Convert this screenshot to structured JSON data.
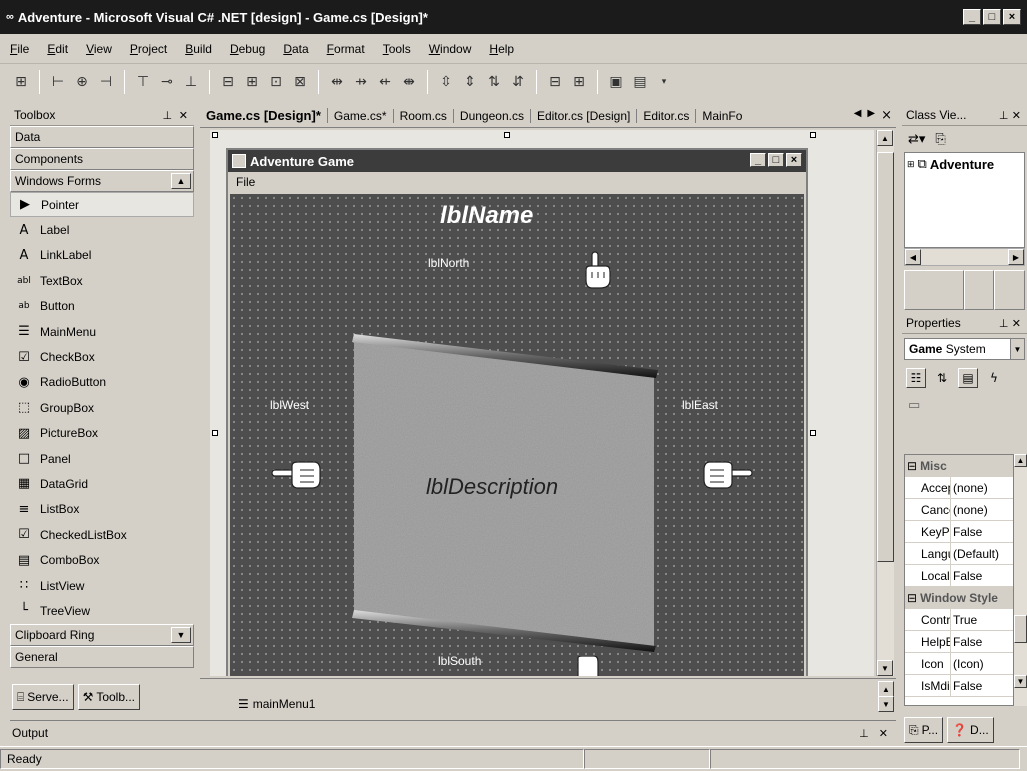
{
  "app": {
    "title": "Adventure - Microsoft Visual C# .NET [design] - Game.cs [Design]*",
    "title_icon": "∞",
    "window_buttons": [
      "_",
      "□",
      "×"
    ]
  },
  "menu": [
    "File",
    "Edit",
    "View",
    "Project",
    "Build",
    "Debug",
    "Data",
    "Format",
    "Tools",
    "Window",
    "Help"
  ],
  "toolbox": {
    "title": "Toolbox",
    "groups_top": [
      "Data",
      "Components",
      "Windows Forms"
    ],
    "items": [
      {
        "label": "Pointer",
        "icon": "▶"
      },
      {
        "label": "Label",
        "icon": "A"
      },
      {
        "label": "LinkLabel",
        "icon": "A"
      },
      {
        "label": "TextBox",
        "icon": "abl"
      },
      {
        "label": "Button",
        "icon": "ab"
      },
      {
        "label": "MainMenu",
        "icon": "☰"
      },
      {
        "label": "CheckBox",
        "icon": "☑"
      },
      {
        "label": "RadioButton",
        "icon": "◉"
      },
      {
        "label": "GroupBox",
        "icon": "⬚"
      },
      {
        "label": "PictureBox",
        "icon": "▨"
      },
      {
        "label": "Panel",
        "icon": "□"
      },
      {
        "label": "DataGrid",
        "icon": "▦"
      },
      {
        "label": "ListBox",
        "icon": "≡"
      },
      {
        "label": "CheckedListBox",
        "icon": "☑"
      },
      {
        "label": "ComboBox",
        "icon": "▤"
      },
      {
        "label": "ListView",
        "icon": "∷"
      },
      {
        "label": "TreeView",
        "icon": "└"
      }
    ],
    "groups_bottom": [
      "Clipboard Ring",
      "General"
    ],
    "bottom_tabs": [
      {
        "label": "Serve...",
        "icon": "⌸"
      },
      {
        "label": "Toolb...",
        "icon": "⚒"
      }
    ]
  },
  "doc_tabs": {
    "items": [
      "Game.cs [Design]*",
      "Game.cs*",
      "Room.cs",
      "Dungeon.cs",
      "Editor.cs [Design]",
      "Editor.cs",
      "MainFo"
    ],
    "active_index": 0,
    "nav": [
      "◀",
      "▶",
      "×"
    ]
  },
  "form": {
    "title": "Adventure Game",
    "menu_item": "File",
    "window_buttons": [
      "_",
      "□",
      "×"
    ],
    "labels": {
      "name": "lblName",
      "north": "lblNorth",
      "south": "lblSouth",
      "west": "lblWest",
      "east": "lblEast",
      "description": "lblDescription"
    }
  },
  "tray": {
    "component": "mainMenu1"
  },
  "class_view": {
    "title": "Class Vie...",
    "tree_root": "Adventure"
  },
  "properties": {
    "title": "Properties",
    "object_name": "Game",
    "object_type": "System",
    "categories": [
      {
        "name": "Misc",
        "rows": [
          {
            "name": "AcceptButton",
            "value": "(none)"
          },
          {
            "name": "CancelButton",
            "value": "(none)"
          },
          {
            "name": "KeyPreview",
            "value": "False"
          },
          {
            "name": "Language",
            "value": "(Default)"
          },
          {
            "name": "Localizable",
            "value": "False"
          }
        ]
      },
      {
        "name": "Window Style",
        "rows": [
          {
            "name": "ControlBox",
            "value": "True"
          },
          {
            "name": "HelpButton",
            "value": "False"
          },
          {
            "name": "Icon",
            "value": "(Icon)"
          },
          {
            "name": "IsMdiContainer",
            "value": "False"
          }
        ]
      }
    ],
    "bottom_tabs": [
      "P...",
      "D..."
    ]
  },
  "output": {
    "title": "Output"
  },
  "status": {
    "text": "Ready"
  },
  "colors": {
    "title_bar": "#1b1b1b",
    "form_client": "#4e4e4e",
    "chrome": "#d4d0c8"
  }
}
